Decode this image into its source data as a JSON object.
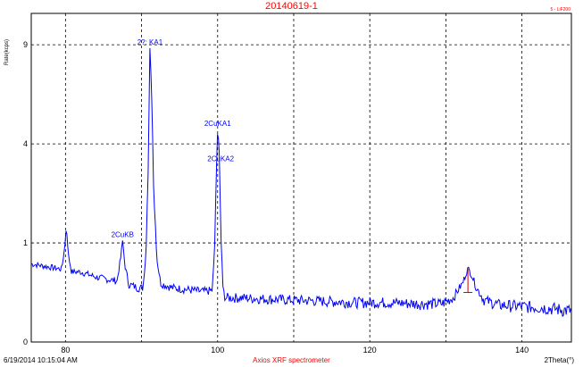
{
  "header": {
    "title": "20140619-1",
    "corner_tag": "5 - LiF200"
  },
  "footer": {
    "timestamp": "6/19/2014 10:15:04 AM",
    "instrument": "Axios XRF spectrometer",
    "axis_unit": "2Theta(°)"
  },
  "colors": {
    "series": "#0000ff",
    "title": "#ff0000",
    "grid": "#000000",
    "marker": "#cc0000"
  },
  "chart_data": {
    "type": "line",
    "ylabel": "Rate(kcps)",
    "xlim": [
      75.5,
      146.5
    ],
    "x_ticks": [
      80,
      100,
      120,
      140
    ],
    "x_grid": [
      80,
      90,
      100,
      110,
      120,
      130,
      140
    ],
    "y_scale": "sqrt",
    "ylim": [
      0,
      11
    ],
    "y_ticks": [
      0,
      1,
      4,
      9
    ],
    "grid": "dashed",
    "series": [
      {
        "points": [
          [
            75.5,
            0.62
          ],
          [
            77,
            0.59
          ],
          [
            78.5,
            0.56
          ],
          [
            79.5,
            0.54
          ],
          [
            79.9,
            0.9
          ],
          [
            80.1,
            1.35
          ],
          [
            80.4,
            0.75
          ],
          [
            80.8,
            0.5
          ],
          [
            82,
            0.5
          ],
          [
            84,
            0.43
          ],
          [
            85.5,
            0.4
          ],
          [
            86.8,
            0.38
          ],
          [
            87.3,
            0.75
          ],
          [
            87.5,
            1.05
          ],
          [
            87.8,
            0.6
          ],
          [
            88.3,
            0.34
          ],
          [
            89.5,
            0.3
          ],
          [
            90.2,
            0.3
          ],
          [
            90.6,
            0.8
          ],
          [
            90.9,
            3.2
          ],
          [
            91.1,
            8.8
          ],
          [
            91.3,
            6.5
          ],
          [
            91.6,
            2.2
          ],
          [
            92,
            0.7
          ],
          [
            92.5,
            0.35
          ],
          [
            94,
            0.3
          ],
          [
            96,
            0.28
          ],
          [
            98,
            0.26
          ],
          [
            99.3,
            0.27
          ],
          [
            99.6,
            0.8
          ],
          [
            99.8,
            2.6
          ],
          [
            100.0,
            4.6
          ],
          [
            100.2,
            3.9
          ],
          [
            100.4,
            1.2
          ],
          [
            100.7,
            0.28
          ],
          [
            101,
            0.2
          ],
          [
            103,
            0.2
          ],
          [
            106,
            0.19
          ],
          [
            110,
            0.18
          ],
          [
            114,
            0.17
          ],
          [
            118,
            0.16
          ],
          [
            122,
            0.16
          ],
          [
            126,
            0.15
          ],
          [
            129.5,
            0.15
          ],
          [
            131,
            0.2
          ],
          [
            132.2,
            0.35
          ],
          [
            132.9,
            0.55
          ],
          [
            133.3,
            0.48
          ],
          [
            134,
            0.3
          ],
          [
            135,
            0.18
          ],
          [
            137,
            0.14
          ],
          [
            140,
            0.13
          ],
          [
            143,
            0.12
          ],
          [
            146.5,
            0.1
          ]
        ]
      }
    ],
    "annotations": [
      {
        "label": "2CuKA1",
        "x": 100.0,
        "y": 4.6
      },
      {
        "label": "2CuKA2",
        "x": 100.4,
        "y": 3.2
      },
      {
        "label": "2CuKB",
        "x": 87.5,
        "y": 1.05
      },
      {
        "label": "2?: KA1",
        "x": 91.1,
        "y": 8.8
      }
    ],
    "markers": [
      {
        "x": 132.9,
        "y_low": 0.25,
        "y_high": 0.55
      }
    ]
  }
}
